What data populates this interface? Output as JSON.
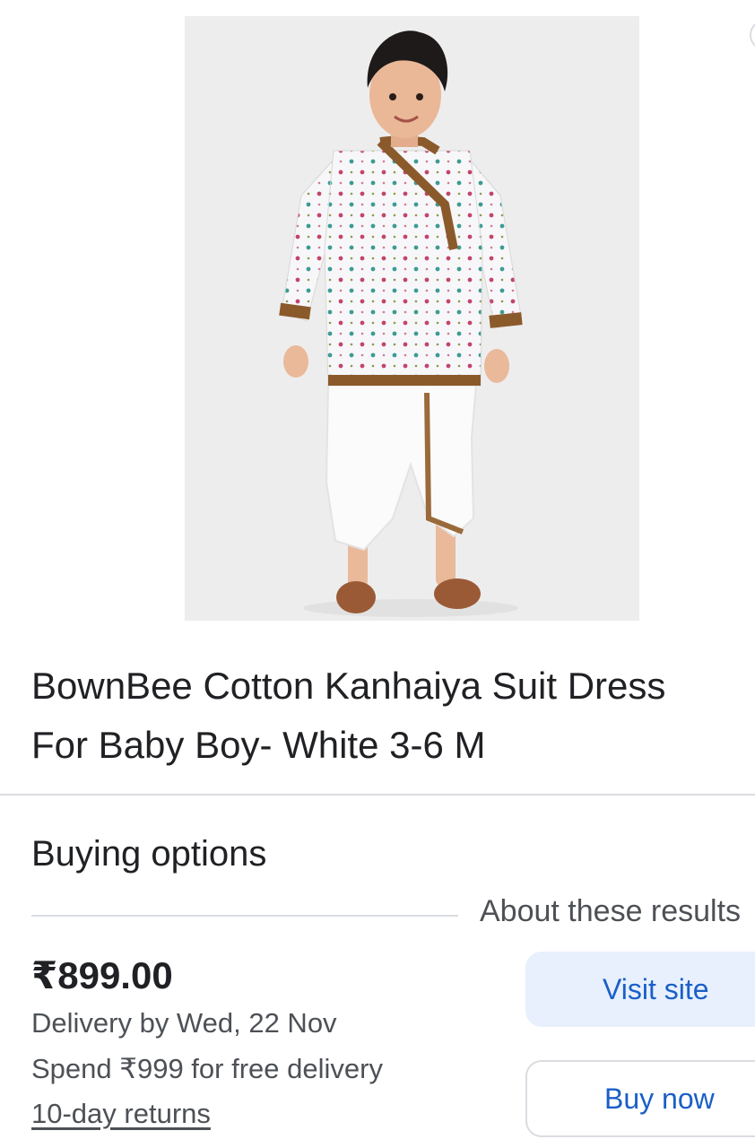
{
  "product": {
    "image_icon": "product-photo-kurta-dhoti",
    "title_line1": "BownBee Cotton Kanhaiya Suit Dress",
    "title_line2": "For Baby Boy- White 3-6 M"
  },
  "buying_options": {
    "heading": "Buying options",
    "about_link": "About these results"
  },
  "offer": {
    "price": "₹899.00",
    "delivery": "Delivery by Wed, 22 Nov",
    "free_delivery": "Spend ₹999 for free delivery",
    "returns": "10-day returns",
    "visit_label": "Visit site",
    "buy_label": "Buy now"
  },
  "colors": {
    "link_blue": "#1a5fc7",
    "visit_bg": "#e8f0fe",
    "divider": "#dadce0",
    "secondary_text": "#4d5156"
  }
}
